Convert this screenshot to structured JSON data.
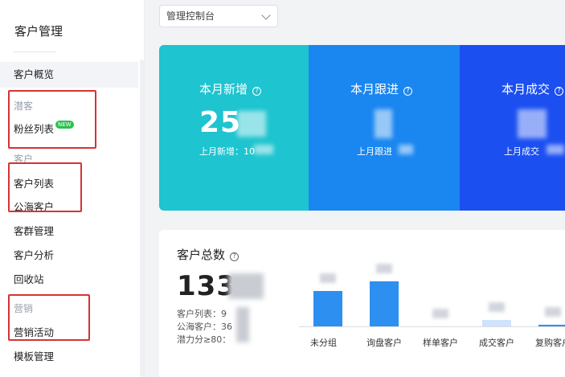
{
  "sidebar": {
    "title": "客户管理",
    "items": {
      "overview": "客户概览",
      "group_potential": "潜客",
      "fans_list": "粉丝列表",
      "fans_badge": "NEW",
      "group_customer": "客户",
      "customer_list": "客户列表",
      "public_sea": "公海客户",
      "group_manage": "客群管理",
      "analysis": "客户分析",
      "recycle": "回收站",
      "group_marketing": "营销",
      "marketing_activity": "营销活动",
      "template_manage": "模板管理"
    }
  },
  "selector": {
    "value": "管理控制台"
  },
  "stats": [
    {
      "title": "本月新增",
      "value": "25",
      "sub": "上月新增：10"
    },
    {
      "title": "本月跟进",
      "value": "",
      "sub": "上月跟进"
    },
    {
      "title": "本月成交",
      "value": "",
      "sub": "上月成交"
    }
  ],
  "total": {
    "title": "客户总数",
    "value": "133",
    "list_line": "客户列表：9",
    "sea_line": "公海客户：36",
    "potential_line": "潜力分≥80："
  },
  "chart_data": {
    "type": "bar",
    "categories": [
      "未分组",
      "询盘客户",
      "样单客户",
      "成交客户",
      "复购客户"
    ],
    "values": [
      44,
      56,
      0,
      8,
      2
    ],
    "ylim": [
      0,
      60
    ],
    "color": "#2d8ff0"
  },
  "colors": {
    "cyan": "#1ec4cf",
    "blue": "#1a86f0",
    "deep_blue": "#1b4ff0",
    "highlight_red": "#d63333",
    "badge_green": "#27c24c"
  }
}
